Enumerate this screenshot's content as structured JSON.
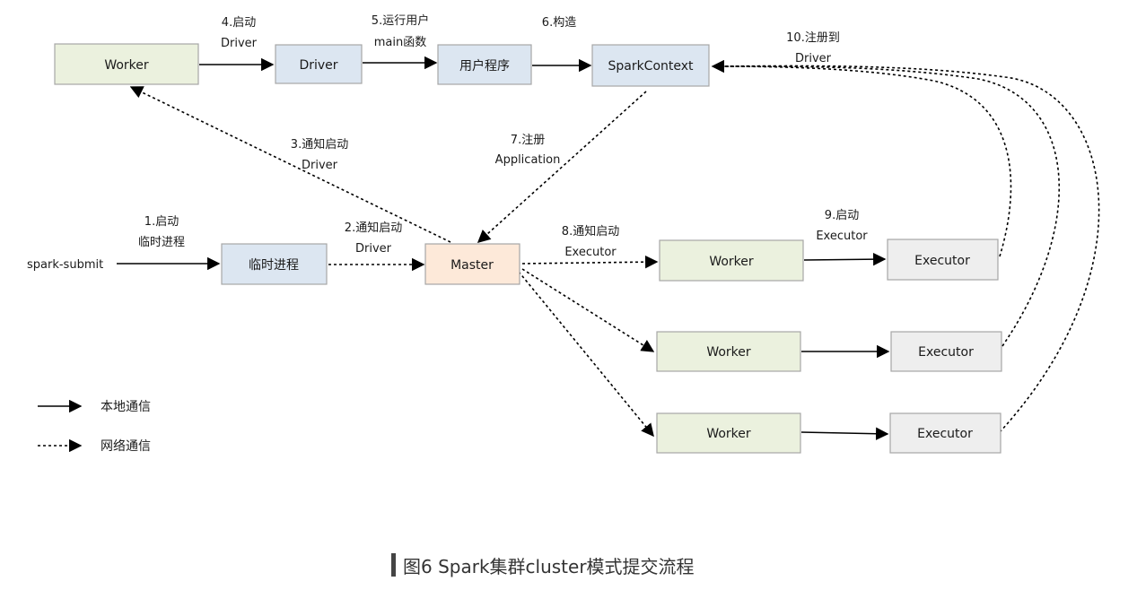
{
  "nodes": {
    "worker_top": {
      "label": "Worker"
    },
    "driver": {
      "label": "Driver"
    },
    "user_program": {
      "label": "用户程序"
    },
    "spark_context": {
      "label": "SparkContext"
    },
    "temp_process": {
      "label": "临时进程"
    },
    "master": {
      "label": "Master"
    },
    "worker_1": {
      "label": "Worker"
    },
    "worker_2": {
      "label": "Worker"
    },
    "worker_3": {
      "label": "Worker"
    },
    "executor_1": {
      "label": "Executor"
    },
    "executor_2": {
      "label": "Executor"
    },
    "executor_3": {
      "label": "Executor"
    },
    "spark_submit": {
      "label": "spark-submit"
    }
  },
  "edges": {
    "e1": {
      "line1": "1.启动",
      "line2": "临时进程"
    },
    "e2": {
      "line1": "2.通知启动",
      "line2": "Driver"
    },
    "e3": {
      "line1": "3.通知启动",
      "line2": "Driver"
    },
    "e4": {
      "line1": "4.启动",
      "line2": "Driver"
    },
    "e5": {
      "line1": "5.运行用户",
      "line2": "main函数"
    },
    "e6": {
      "line1": "6.构造"
    },
    "e7": {
      "line1": "7.注册",
      "line2": "Application"
    },
    "e8": {
      "line1": "8.通知启动",
      "line2": "Executor"
    },
    "e9": {
      "line1": "9.启动",
      "line2": "Executor"
    },
    "e10": {
      "line1": "10.注册到",
      "line2": "Driver"
    }
  },
  "legend": {
    "local": "本地通信",
    "network": "网络通信"
  },
  "caption": "图6 Spark集群cluster模式提交流程",
  "colors": {
    "worker_fill": "#ebf1de",
    "driver_fill": "#dce6f1",
    "master_fill": "#fde9d9",
    "executor_fill": "#eeeeee",
    "box_stroke": "#a6a6a6",
    "line": "#000000"
  }
}
